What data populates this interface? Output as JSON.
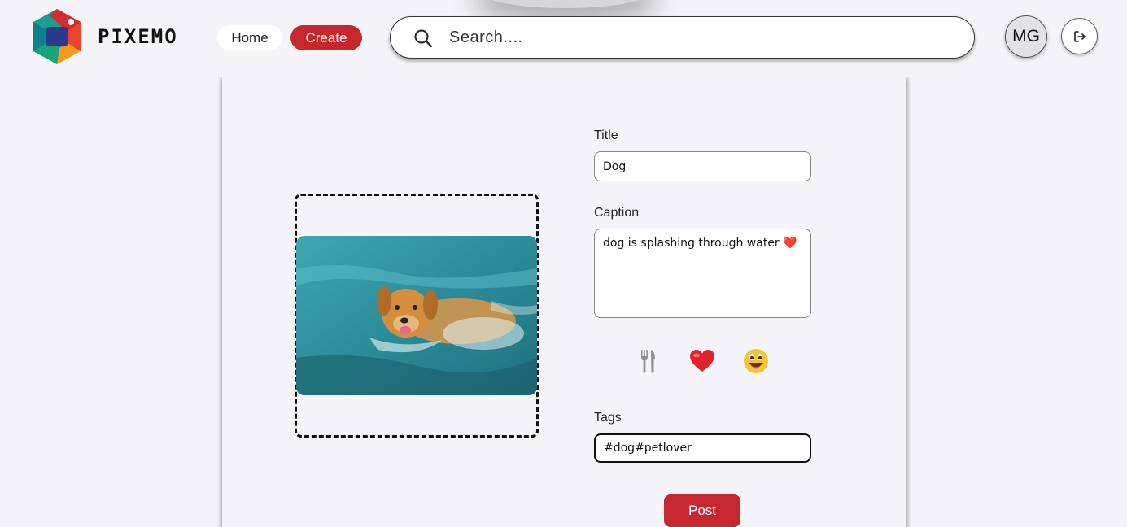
{
  "header": {
    "brand": "PIXEMO",
    "nav": {
      "home": "Home",
      "create": "Create"
    },
    "search": {
      "placeholder": "Search...."
    },
    "avatar_initials": "MG"
  },
  "form": {
    "title_label": "Title",
    "title_value": "Dog",
    "caption_label": "Caption",
    "caption_value": "dog is splashing through water ❤️",
    "emoji_buttons": [
      "fork-knife-icon",
      "heart-icon",
      "grinning-face-icon"
    ],
    "tags_label": "Tags",
    "tags_value": "#dog#petlover",
    "post_label": "Post"
  },
  "colors": {
    "accent": "#c6272f",
    "background": "#f5f5f9"
  }
}
